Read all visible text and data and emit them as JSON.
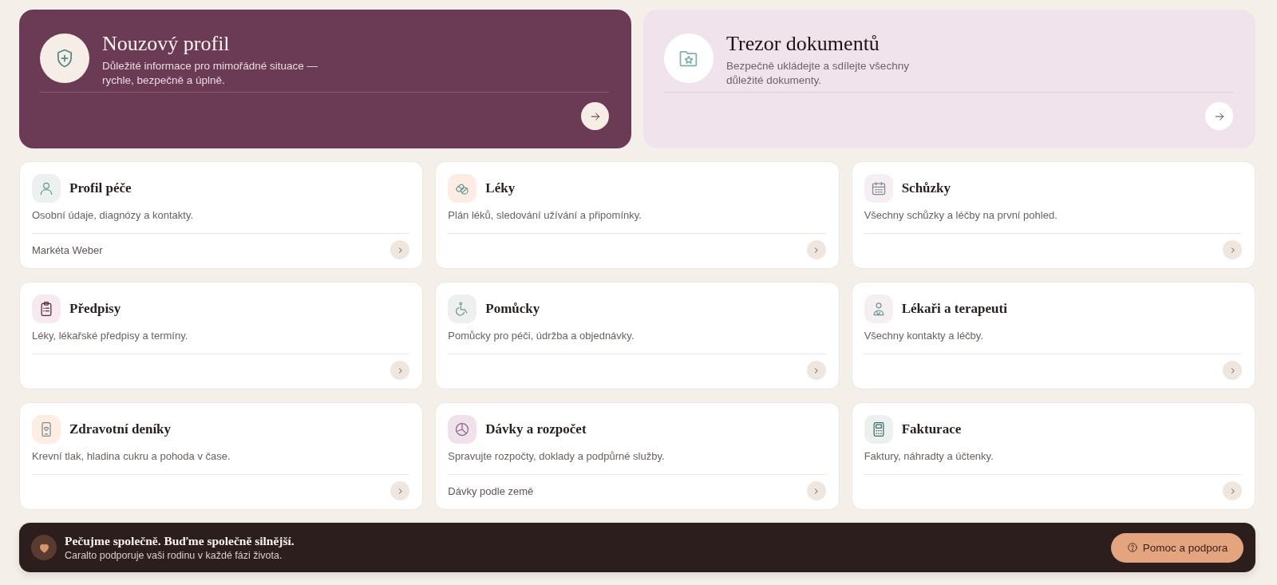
{
  "hero_cards": [
    {
      "kind": "dark",
      "title": "Nouzový profil",
      "description": "Důležité informace pro mimořádné situace — rychle, bezpečně a úplně."
    },
    {
      "kind": "light",
      "title": "Trezor dokumentů",
      "description": "Bezpečně ukládejte a sdílejte všechny důležité dokumenty."
    }
  ],
  "cards": [
    {
      "title": "Profil péče",
      "description": "Osobní údaje, diagnózy a kontakty.",
      "detail": "Markéta Weber",
      "color": "#ecf0ee"
    },
    {
      "title": "Léky",
      "description": "Plán léků, sledování užívání a připomínky.",
      "color": "#fcece3"
    },
    {
      "title": "Schůzky",
      "description": "Všechny schůzky a léčby na první pohled.",
      "color": "#f7eef1"
    },
    {
      "title": "Předpisy",
      "description": "Léky, lékařské předpisy a termíny.",
      "color": "#f6e9f0"
    },
    {
      "title": "Pomůcky",
      "description": "Pomůcky pro péči, údržba a objednávky.",
      "color": "#edf0ee"
    },
    {
      "title": "Lékaři a terapeuti",
      "description": "Všechny kontakty a léčby.",
      "color": "#f6eff1"
    },
    {
      "title": "Zdravotní deníky",
      "description": "Krevní tlak, hladina cukru a pohoda v čase.",
      "color": "#fdede3"
    },
    {
      "title": "Dávky a rozpočet",
      "description": "Spravujte rozpočty, doklady a podpůrné služby.",
      "detail": "Dávky podle země",
      "color": "#f1e1ec"
    },
    {
      "title": "Fakturace",
      "description": "Faktury, náhradty a účtenky.",
      "color": "#ecf0ee"
    }
  ],
  "banner": {
    "title": "Pečujme společně. Buďme společně silnější.",
    "subtitle": "Caralto podporuje vaši rodinu v každé fázi života.",
    "button": "Pomoc a podpora"
  }
}
